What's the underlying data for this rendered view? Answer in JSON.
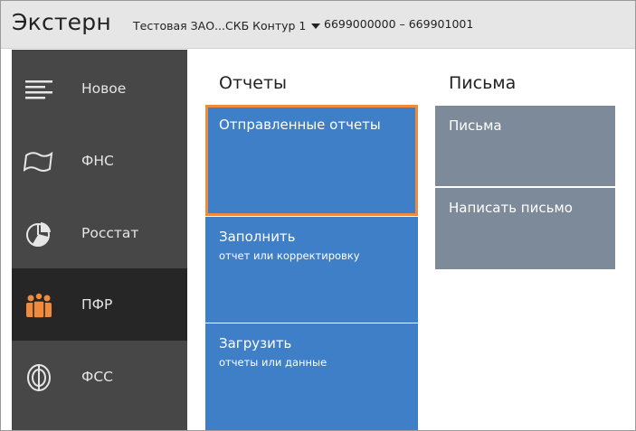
{
  "header": {
    "app_title": "Экстерн",
    "org_name": "Тестовая ЗАО...СКБ Контур 1",
    "org_ids": "6699000000 – 669901001"
  },
  "sidebar": {
    "items": [
      {
        "label": "Новое",
        "icon": "news-lines-icon",
        "active": false
      },
      {
        "label": "ФНС",
        "icon": "flag-icon",
        "active": false
      },
      {
        "label": "Росстат",
        "icon": "pie-chart-icon",
        "active": false
      },
      {
        "label": "ПФР",
        "icon": "people-icon",
        "active": true
      },
      {
        "label": "ФСС",
        "icon": "shield-target-icon",
        "active": false
      }
    ]
  },
  "reports": {
    "title": "Отчеты",
    "tiles": [
      {
        "label": "Отправленные отчеты",
        "sub": "",
        "selected": true
      },
      {
        "label": "Заполнить",
        "sub": "отчет или корректировку"
      },
      {
        "label": "Загрузить",
        "sub": "отчеты или данные"
      }
    ]
  },
  "letters": {
    "title": "Письма",
    "tiles": [
      {
        "label": "Письма"
      },
      {
        "label": "Написать письмо"
      }
    ]
  },
  "colors": {
    "sidebar_bg": "#474747",
    "sidebar_active": "#262626",
    "tile_blue": "#3f7fc8",
    "tile_gray": "#7d8a9a",
    "accent_orange": "#f08a3c",
    "header_bg": "#e6e6e6"
  }
}
